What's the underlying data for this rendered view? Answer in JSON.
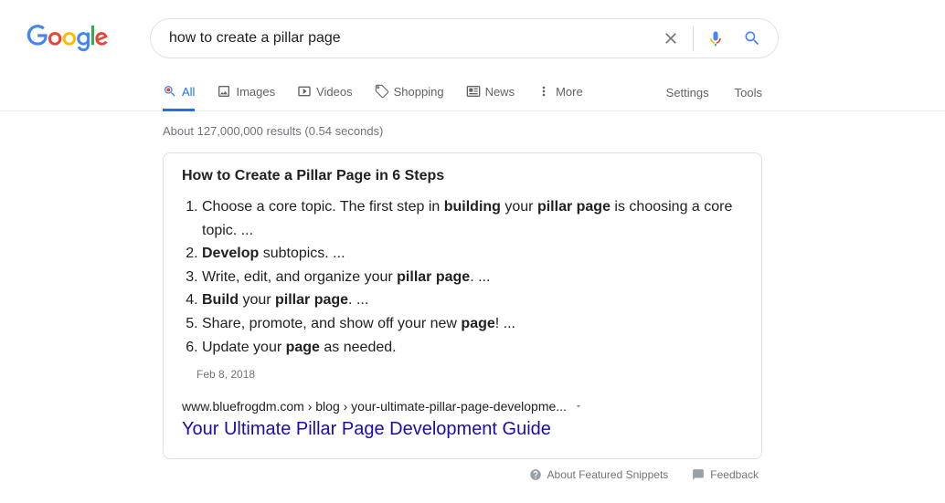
{
  "search": {
    "query": "how to create a pillar page"
  },
  "tabs": {
    "all": "All",
    "images": "Images",
    "videos": "Videos",
    "shopping": "Shopping",
    "news": "News",
    "more": "More"
  },
  "tools": {
    "settings": "Settings",
    "tools": "Tools"
  },
  "result_stats": "About 127,000,000 results (0.54 seconds)",
  "snippet": {
    "heading": "How to Create a Pillar Page in 6 Steps",
    "date": "Feb 8, 2018",
    "url_display": "www.bluefrogdm.com › blog › your-ultimate-pillar-page-developme...",
    "link_title": "Your Ultimate Pillar Page Development Guide",
    "steps": [
      {
        "pre": "Choose a core topic. The first step in ",
        "b1": "building",
        "mid1": " your ",
        "b2": "pillar page",
        "post": " is choosing a core topic. ..."
      },
      {
        "b1": "Develop",
        "post": " subtopics. ..."
      },
      {
        "pre": "Write, edit, and organize your ",
        "b1": "pillar page",
        "post": ". ..."
      },
      {
        "b1": "Build",
        "mid1": " your ",
        "b2": "pillar page",
        "post": ". ..."
      },
      {
        "pre": "Share, promote, and show off your new ",
        "b1": "page",
        "post": "! ..."
      },
      {
        "pre": "Update your ",
        "b1": "page",
        "post": " as needed."
      }
    ]
  },
  "footer": {
    "about": "About Featured Snippets",
    "feedback": "Feedback"
  }
}
